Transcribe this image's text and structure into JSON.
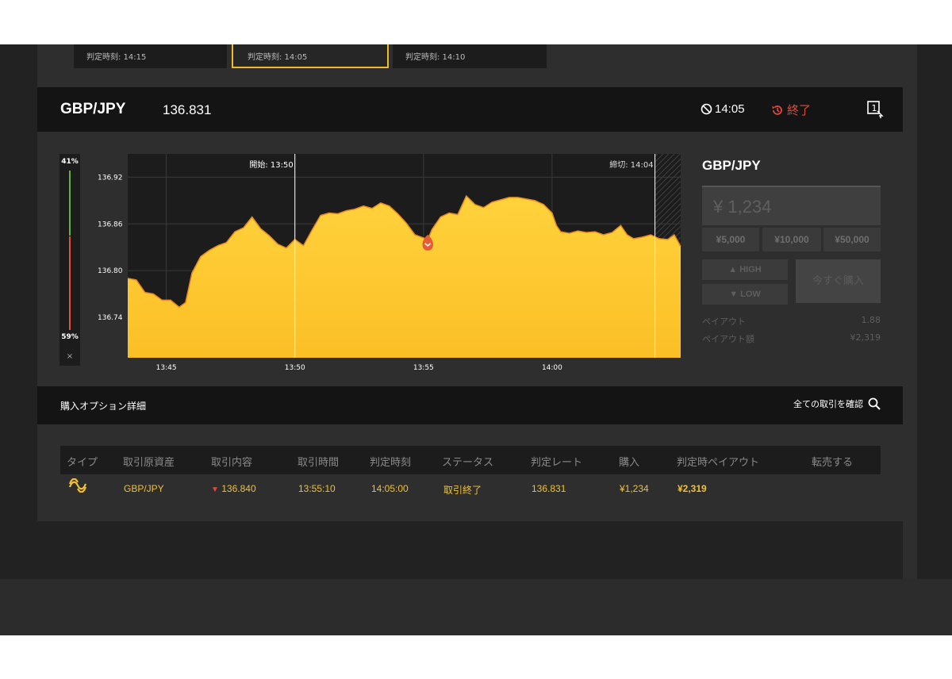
{
  "tabs": [
    {
      "label": "判定時刻: 14:15"
    },
    {
      "label": "判定時刻: 14:05"
    },
    {
      "label": "判定時刻: 14:10"
    }
  ],
  "asset": {
    "name": "GBP/JPY",
    "rate": "136.831",
    "expiry": "14:05",
    "status": "終了"
  },
  "sentiment": {
    "high": "41%",
    "low": "59%",
    "close": "×"
  },
  "chart_data": {
    "type": "area",
    "title": "",
    "xlabel": "",
    "ylabel": "",
    "x_ticks": [
      "13:45",
      "13:50",
      "13:55",
      "14:00"
    ],
    "y_ticks": [
      "136.92",
      "136.86",
      "136.80",
      "136.74"
    ],
    "ylim": [
      136.688,
      136.95
    ],
    "start_label": "開始: 13:50",
    "close_label": "締切: 14:04",
    "entry_rate": 136.84,
    "series": [
      {
        "values": [
          {
            "t": "13:43:30",
            "v": 136.79
          },
          {
            "t": "13:43:50",
            "v": 136.788
          },
          {
            "t": "13:44:10",
            "v": 136.772
          },
          {
            "t": "13:44:30",
            "v": 136.77
          },
          {
            "t": "13:44:50",
            "v": 136.762
          },
          {
            "t": "13:45:10",
            "v": 136.762
          },
          {
            "t": "13:45:30",
            "v": 136.753
          },
          {
            "t": "13:45:45",
            "v": 136.759
          },
          {
            "t": "13:46:00",
            "v": 136.797
          },
          {
            "t": "13:46:20",
            "v": 136.818
          },
          {
            "t": "13:46:40",
            "v": 136.826
          },
          {
            "t": "13:47:00",
            "v": 136.832
          },
          {
            "t": "13:47:20",
            "v": 136.836
          },
          {
            "t": "13:47:40",
            "v": 136.85
          },
          {
            "t": "13:48:00",
            "v": 136.855
          },
          {
            "t": "13:48:20",
            "v": 136.869
          },
          {
            "t": "13:48:40",
            "v": 136.854
          },
          {
            "t": "13:49:00",
            "v": 136.845
          },
          {
            "t": "13:49:20",
            "v": 136.834
          },
          {
            "t": "13:49:40",
            "v": 136.829
          },
          {
            "t": "13:50:00",
            "v": 136.84
          },
          {
            "t": "13:50:20",
            "v": 136.832
          },
          {
            "t": "13:50:40",
            "v": 136.852
          },
          {
            "t": "13:51:00",
            "v": 136.871
          },
          {
            "t": "13:51:20",
            "v": 136.874
          },
          {
            "t": "13:51:40",
            "v": 136.873
          },
          {
            "t": "13:52:00",
            "v": 136.877
          },
          {
            "t": "13:52:20",
            "v": 136.879
          },
          {
            "t": "13:52:40",
            "v": 136.883
          },
          {
            "t": "13:53:00",
            "v": 136.88
          },
          {
            "t": "13:53:20",
            "v": 136.887
          },
          {
            "t": "13:53:40",
            "v": 136.883
          },
          {
            "t": "13:54:00",
            "v": 136.873
          },
          {
            "t": "13:54:20",
            "v": 136.861
          },
          {
            "t": "13:54:40",
            "v": 136.846
          },
          {
            "t": "13:55:00",
            "v": 136.842
          },
          {
            "t": "13:55:10",
            "v": 136.84
          },
          {
            "t": "13:55:20",
            "v": 136.853
          },
          {
            "t": "13:55:40",
            "v": 136.869
          },
          {
            "t": "13:56:00",
            "v": 136.874
          },
          {
            "t": "13:56:20",
            "v": 136.872
          },
          {
            "t": "13:56:40",
            "v": 136.896
          },
          {
            "t": "13:57:00",
            "v": 136.885
          },
          {
            "t": "13:57:20",
            "v": 136.881
          },
          {
            "t": "13:57:40",
            "v": 136.888
          },
          {
            "t": "13:58:00",
            "v": 136.891
          },
          {
            "t": "13:58:20",
            "v": 136.894
          },
          {
            "t": "13:58:40",
            "v": 136.894
          },
          {
            "t": "13:59:00",
            "v": 136.892
          },
          {
            "t": "13:59:20",
            "v": 136.89
          },
          {
            "t": "13:59:40",
            "v": 136.885
          },
          {
            "t": "14:00:00",
            "v": 136.874
          },
          {
            "t": "14:00:10",
            "v": 136.858
          },
          {
            "t": "14:00:20",
            "v": 136.85
          },
          {
            "t": "14:00:40",
            "v": 136.848
          },
          {
            "t": "14:01:00",
            "v": 136.851
          },
          {
            "t": "14:01:20",
            "v": 136.849
          },
          {
            "t": "14:01:40",
            "v": 136.85
          },
          {
            "t": "14:02:00",
            "v": 136.846
          },
          {
            "t": "14:02:20",
            "v": 136.849
          },
          {
            "t": "14:02:40",
            "v": 136.858
          },
          {
            "t": "14:02:55",
            "v": 136.846
          },
          {
            "t": "14:03:10",
            "v": 136.841
          },
          {
            "t": "14:03:30",
            "v": 136.843
          },
          {
            "t": "14:03:50",
            "v": 136.846
          },
          {
            "t": "14:04:10",
            "v": 136.841
          },
          {
            "t": "14:04:30",
            "v": 136.84
          },
          {
            "t": "14:04:45",
            "v": 136.846
          },
          {
            "t": "14:05:00",
            "v": 136.831
          }
        ]
      }
    ]
  },
  "trade_panel": {
    "title": "GBP/JPY",
    "amount": "¥ 1,234",
    "amounts": [
      "¥5,000",
      "¥10,000",
      "¥50,000"
    ],
    "high_label": "HIGH",
    "low_label": "LOW",
    "buy_label": "今すぐ購入",
    "payout_label": "ペイアウト",
    "payout_value": "1.88",
    "payout_amount_label": "ペイアウト額",
    "payout_amount_value": "¥2,319"
  },
  "details": {
    "title": "購入オプション詳細",
    "all_trades": "全ての取引を確認"
  },
  "table": {
    "headers": [
      "タイプ",
      "取引原資産",
      "取引内容",
      "取引時間",
      "判定時刻",
      "ステータス",
      "判定レート",
      "購入",
      "判定時ペイアウト",
      "転売する"
    ],
    "row": {
      "asset": "GBP/JPY",
      "content": "136.840",
      "trade_time": "13:55:10",
      "expiry": "14:05:00",
      "status": "取引終了",
      "rate": "136.831",
      "purchase": "¥1,234",
      "payout": "¥2,319"
    }
  },
  "colors": {
    "accent": "#f0b929",
    "area": "#ffc830",
    "down": "#e04a3a",
    "up": "#63b33b"
  }
}
